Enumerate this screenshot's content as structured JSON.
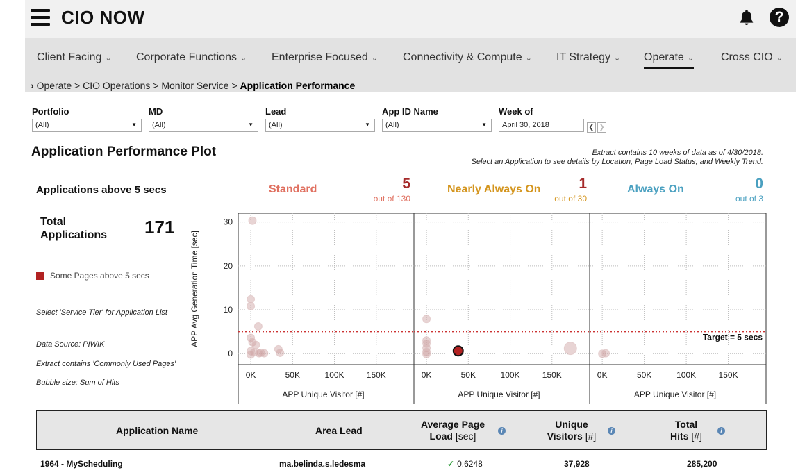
{
  "header": {
    "title": "CIO NOW"
  },
  "nav": {
    "items": [
      {
        "label": "Client Facing"
      },
      {
        "label": "Corporate Functions"
      },
      {
        "label": "Enterprise Focused"
      },
      {
        "label": "Connectivity & Compute"
      },
      {
        "label": "IT Strategy"
      },
      {
        "label": "Operate"
      },
      {
        "label": "Cross CIO"
      }
    ],
    "active": "Operate"
  },
  "breadcrumb": {
    "path": "Operate > CIO Operations > Monitor Service > ",
    "current": "Application Performance"
  },
  "filters": {
    "portfolio": {
      "label": "Portfolio",
      "value": "(All)"
    },
    "md": {
      "label": "MD",
      "value": "(All)"
    },
    "lead": {
      "label": "Lead",
      "value": "(All)"
    },
    "app_id": {
      "label": "App ID Name",
      "value": "(All)"
    },
    "week": {
      "label": "Week of",
      "value": "April 30, 2018"
    }
  },
  "section": {
    "title": "Application Performance Plot",
    "note_line1": "Extract contains 10 weeks of data as of 4/30/2018.",
    "note_line2": "Select an Application to see details by Location, Page Load Status, and Weekly Trend."
  },
  "summary": {
    "apps_above": "Applications above 5 secs",
    "total_label_1": "Total",
    "total_label_2": "Applications",
    "total_value": "171",
    "legend_label": "Some Pages above 5 secs",
    "legend_color": "#b22222",
    "note_select": "Select 'Service Tier' for Application List",
    "note_source": "Data Source: PIWIK",
    "note_extract": "Extract contains 'Commonly Used Pages'",
    "note_bubble": "Bubble size: Sum of Hits"
  },
  "tiers": [
    {
      "name": "Standard",
      "count": "5",
      "total": "out of 130",
      "color": "#e07060",
      "count_color": "#a52a2a"
    },
    {
      "name": "Nearly Always On",
      "count": "1",
      "total": "out of 30",
      "color": "#d4951e",
      "count_color": "#a52a2a"
    },
    {
      "name": "Always On",
      "count": "0",
      "total": "out of 3",
      "color": "#4aa0c0",
      "count_color": "#4aa0c0"
    }
  ],
  "chart_data": {
    "type": "scatter",
    "ylabel": "APP Avg Generation Time [sec]",
    "xlabel": "APP Unique Visitor [#]",
    "ylim": [
      -2.5,
      32
    ],
    "xlim": [
      -15000,
      195000
    ],
    "yticks": [
      "0",
      "10",
      "20",
      "30"
    ],
    "xticks": [
      "0K",
      "50K",
      "100K",
      "150K"
    ],
    "target_line": {
      "value": 5,
      "label": "Target = 5 secs",
      "color": "#cc3333"
    },
    "panels": [
      {
        "tier": "Standard",
        "points": [
          {
            "x": 2000,
            "y": 30.3
          },
          {
            "x": 0,
            "y": 12.4
          },
          {
            "x": 0,
            "y": 10.8
          },
          {
            "x": 9000,
            "y": 6.2
          },
          {
            "x": 0,
            "y": 3.6
          },
          {
            "x": 2000,
            "y": 2.6
          },
          {
            "x": 6000,
            "y": 2.0
          },
          {
            "x": 0,
            "y": 0.6
          },
          {
            "x": 4000,
            "y": 0.3
          },
          {
            "x": 12000,
            "y": 0.2
          },
          {
            "x": 16000,
            "y": 0.1
          },
          {
            "x": 33000,
            "y": 1.0
          },
          {
            "x": 35000,
            "y": 0.2
          },
          {
            "x": 0,
            "y": -0.2
          },
          {
            "x": 10000,
            "y": 0.1
          }
        ]
      },
      {
        "tier": "Nearly Always On",
        "points": [
          {
            "x": 0,
            "y": 7.9
          },
          {
            "x": 0,
            "y": 3.0
          },
          {
            "x": 0,
            "y": 2.3
          },
          {
            "x": 0,
            "y": 1.3
          },
          {
            "x": 0,
            "y": 0.4
          },
          {
            "x": 0,
            "y": -0.1
          },
          {
            "x": 37928,
            "y": 0.6248,
            "highlight": true
          },
          {
            "x": 172000,
            "y": 1.2
          }
        ]
      },
      {
        "tier": "Always On",
        "points": [
          {
            "x": 0,
            "y": 0.0
          },
          {
            "x": 4000,
            "y": 0.1
          }
        ]
      }
    ]
  },
  "table": {
    "headers": {
      "app_name": "Application Name",
      "area_lead": "Area Lead",
      "avg_load_1": "Average Page",
      "avg_load_2": "Load",
      "avg_load_unit": "[sec]",
      "visitors_1": "Unique",
      "visitors_2": "Visitors",
      "visitors_unit": "[#]",
      "hits_1": "Total",
      "hits_2": "Hits",
      "hits_unit": "[#]"
    },
    "rows": [
      {
        "app_name": "1964 - MyScheduling",
        "area_lead": "ma.belinda.s.ledesma",
        "avg_load": "0.6248",
        "visitors": "37,928",
        "hits": "285,200"
      }
    ]
  }
}
